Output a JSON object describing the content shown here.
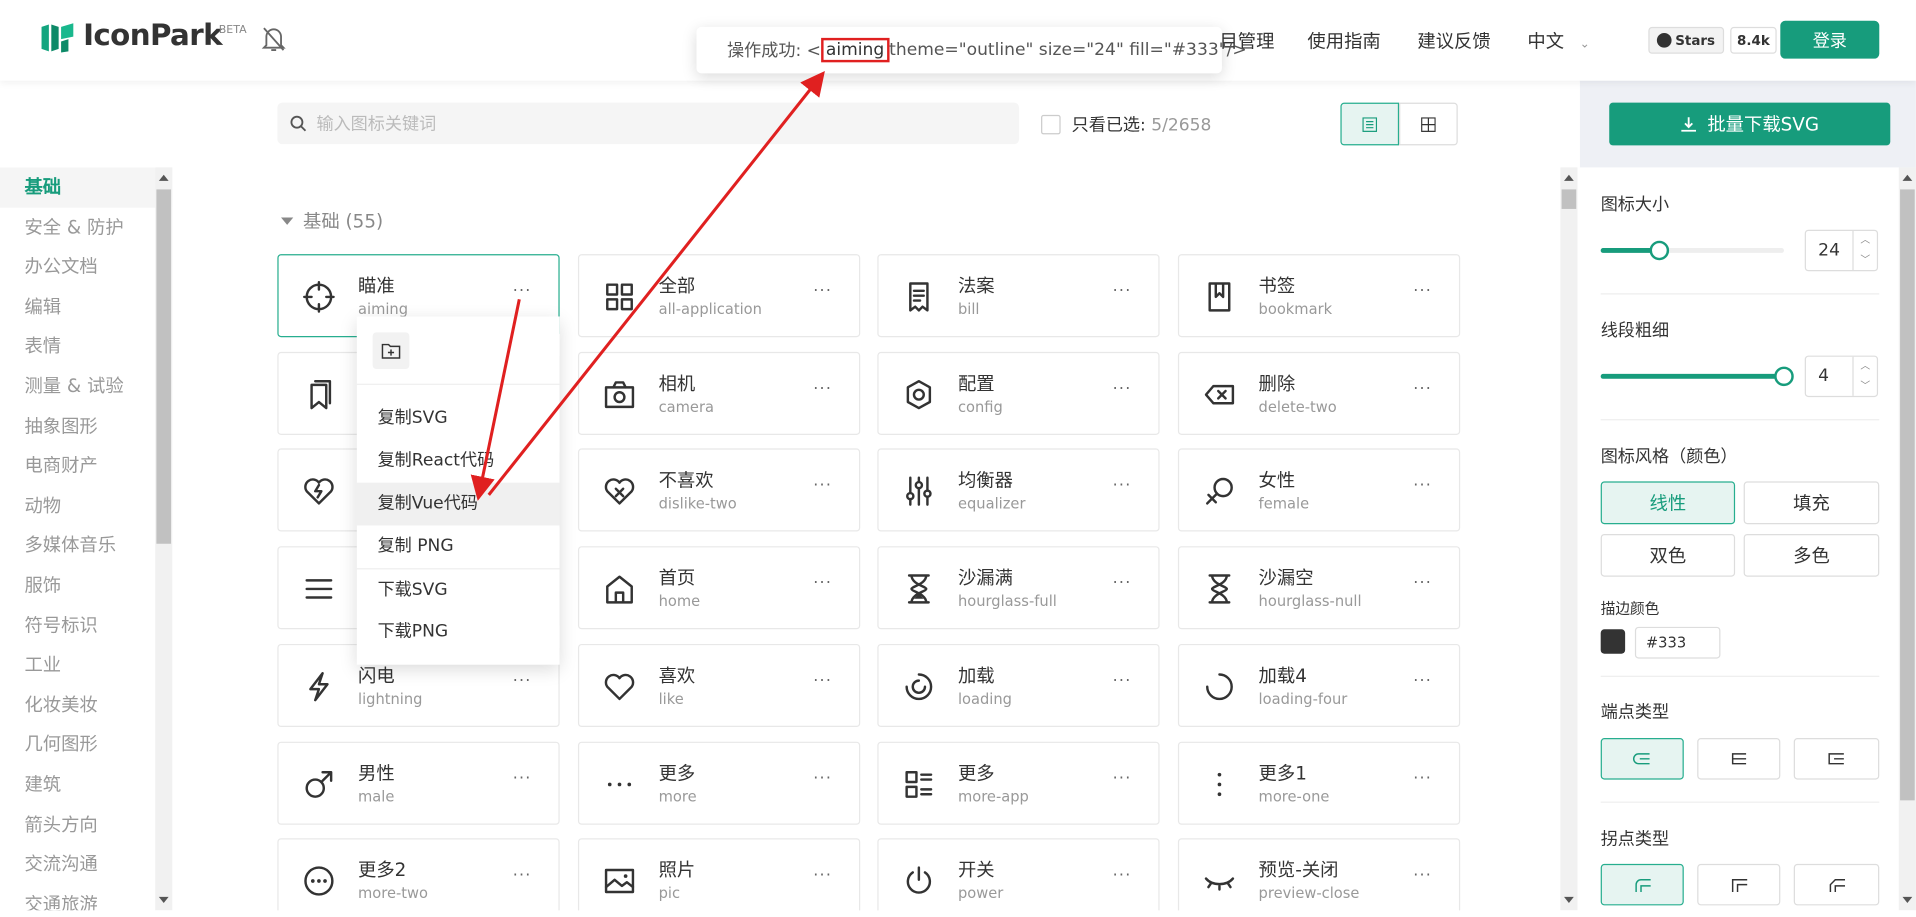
{
  "header": {
    "logo_text": "IconPark",
    "beta": "BETA",
    "nav": [
      "目管理",
      "使用指南",
      "建议反馈",
      "中文"
    ],
    "github_label": "Stars",
    "github_count": "8.4k",
    "login": "登录"
  },
  "toast": {
    "prefix": "操作成功: <",
    "highlight": "aiming",
    "suffix": " theme=\"outline\" size=\"24\" fill=\"#333\"/>"
  },
  "search": {
    "placeholder": "输入图标关键词"
  },
  "filter": {
    "label": "只看已选:",
    "count": "5/2658"
  },
  "sidebar": {
    "items": [
      "基础",
      "安全 & 防护",
      "办公文档",
      "编辑",
      "表情",
      "测量 & 试验",
      "抽象图形",
      "电商财产",
      "动物",
      "多媒体音乐",
      "服饰",
      "符号标识",
      "工业",
      "化妆美妆",
      "几何图形",
      "建筑",
      "箭头方向",
      "交流沟通",
      "交通旅游"
    ]
  },
  "section": {
    "title": "基础 (55)"
  },
  "icons": [
    {
      "cn": "瞄准",
      "en": "aiming",
      "icon": "aiming-icon"
    },
    {
      "cn": "全部",
      "en": "all-application",
      "icon": "all-application-icon"
    },
    {
      "cn": "法案",
      "en": "bill",
      "icon": "bill-icon"
    },
    {
      "cn": "书签",
      "en": "bookmark",
      "icon": "bookmark-icon"
    },
    {
      "cn": "",
      "en": "",
      "icon": "bookmark-multi-icon"
    },
    {
      "cn": "相机",
      "en": "camera",
      "icon": "camera-icon"
    },
    {
      "cn": "配置",
      "en": "config",
      "icon": "config-icon"
    },
    {
      "cn": "删除",
      "en": "delete-two",
      "icon": "delete-two-icon"
    },
    {
      "cn": "",
      "en": "",
      "icon": "broken-heart-icon"
    },
    {
      "cn": "不喜欢",
      "en": "dislike-two",
      "icon": "dislike-two-icon"
    },
    {
      "cn": "均衡器",
      "en": "equalizer",
      "icon": "equalizer-icon"
    },
    {
      "cn": "女性",
      "en": "female",
      "icon": "female-icon"
    },
    {
      "cn": "",
      "en": "",
      "icon": "hamburger-icon"
    },
    {
      "cn": "首页",
      "en": "home",
      "icon": "home-icon"
    },
    {
      "cn": "沙漏满",
      "en": "hourglass-full",
      "icon": "hourglass-full-icon"
    },
    {
      "cn": "沙漏空",
      "en": "hourglass-null",
      "icon": "hourglass-null-icon"
    },
    {
      "cn": "闪电",
      "en": "lightning",
      "icon": "lightning-icon"
    },
    {
      "cn": "喜欢",
      "en": "like",
      "icon": "like-icon"
    },
    {
      "cn": "加载",
      "en": "loading",
      "icon": "loading-icon"
    },
    {
      "cn": "加载4",
      "en": "loading-four",
      "icon": "loading-four-icon"
    },
    {
      "cn": "男性",
      "en": "male",
      "icon": "male-icon"
    },
    {
      "cn": "更多",
      "en": "more",
      "icon": "more-icon"
    },
    {
      "cn": "更多",
      "en": "more-app",
      "icon": "more-app-icon"
    },
    {
      "cn": "更多1",
      "en": "more-one",
      "icon": "more-one-icon"
    },
    {
      "cn": "更多2",
      "en": "more-two",
      "icon": "more-two-icon"
    },
    {
      "cn": "照片",
      "en": "pic",
      "icon": "pic-icon"
    },
    {
      "cn": "开关",
      "en": "power",
      "icon": "power-icon"
    },
    {
      "cn": "预览-关闭",
      "en": "preview-close",
      "icon": "preview-close-icon"
    }
  ],
  "more_label": "···",
  "context_menu": {
    "items": [
      "复制SVG",
      "复制React代码",
      "复制Vue代码",
      "复制 PNG",
      "下载SVG",
      "下载PNG"
    ]
  },
  "panel": {
    "bulk_download": "批量下载SVG",
    "size_label": "图标大小",
    "size_value": "24",
    "size_fraction": 0.32,
    "stroke_label": "线段粗细",
    "stroke_value": "4",
    "stroke_fraction": 1.0,
    "style_label": "图标风格（颜色）",
    "styles": [
      "线性",
      "填充",
      "双色",
      "多色"
    ],
    "stroke_color_label": "描边颜色",
    "stroke_color": "#333",
    "cap_label": "端点类型",
    "join_label": "拐点类型"
  },
  "colors": {
    "accent": "#179c7c",
    "toast_ok": "#52c41a",
    "annotation": "#e02020"
  }
}
